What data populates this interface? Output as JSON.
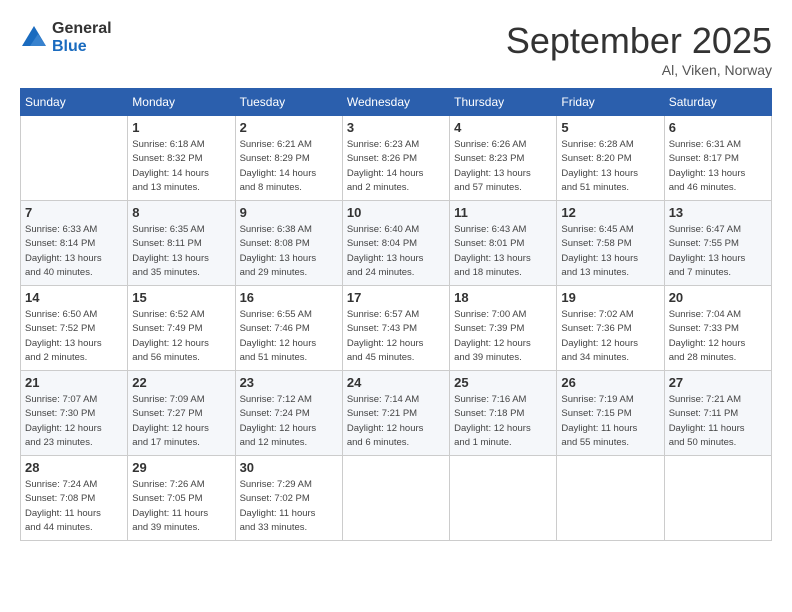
{
  "header": {
    "logo_general": "General",
    "logo_blue": "Blue",
    "month_title": "September 2025",
    "subtitle": "Al, Viken, Norway"
  },
  "weekdays": [
    "Sunday",
    "Monday",
    "Tuesday",
    "Wednesday",
    "Thursday",
    "Friday",
    "Saturday"
  ],
  "weeks": [
    [
      {
        "day": "",
        "info": ""
      },
      {
        "day": "1",
        "info": "Sunrise: 6:18 AM\nSunset: 8:32 PM\nDaylight: 14 hours\nand 13 minutes."
      },
      {
        "day": "2",
        "info": "Sunrise: 6:21 AM\nSunset: 8:29 PM\nDaylight: 14 hours\nand 8 minutes."
      },
      {
        "day": "3",
        "info": "Sunrise: 6:23 AM\nSunset: 8:26 PM\nDaylight: 14 hours\nand 2 minutes."
      },
      {
        "day": "4",
        "info": "Sunrise: 6:26 AM\nSunset: 8:23 PM\nDaylight: 13 hours\nand 57 minutes."
      },
      {
        "day": "5",
        "info": "Sunrise: 6:28 AM\nSunset: 8:20 PM\nDaylight: 13 hours\nand 51 minutes."
      },
      {
        "day": "6",
        "info": "Sunrise: 6:31 AM\nSunset: 8:17 PM\nDaylight: 13 hours\nand 46 minutes."
      }
    ],
    [
      {
        "day": "7",
        "info": "Sunrise: 6:33 AM\nSunset: 8:14 PM\nDaylight: 13 hours\nand 40 minutes."
      },
      {
        "day": "8",
        "info": "Sunrise: 6:35 AM\nSunset: 8:11 PM\nDaylight: 13 hours\nand 35 minutes."
      },
      {
        "day": "9",
        "info": "Sunrise: 6:38 AM\nSunset: 8:08 PM\nDaylight: 13 hours\nand 29 minutes."
      },
      {
        "day": "10",
        "info": "Sunrise: 6:40 AM\nSunset: 8:04 PM\nDaylight: 13 hours\nand 24 minutes."
      },
      {
        "day": "11",
        "info": "Sunrise: 6:43 AM\nSunset: 8:01 PM\nDaylight: 13 hours\nand 18 minutes."
      },
      {
        "day": "12",
        "info": "Sunrise: 6:45 AM\nSunset: 7:58 PM\nDaylight: 13 hours\nand 13 minutes."
      },
      {
        "day": "13",
        "info": "Sunrise: 6:47 AM\nSunset: 7:55 PM\nDaylight: 13 hours\nand 7 minutes."
      }
    ],
    [
      {
        "day": "14",
        "info": "Sunrise: 6:50 AM\nSunset: 7:52 PM\nDaylight: 13 hours\nand 2 minutes."
      },
      {
        "day": "15",
        "info": "Sunrise: 6:52 AM\nSunset: 7:49 PM\nDaylight: 12 hours\nand 56 minutes."
      },
      {
        "day": "16",
        "info": "Sunrise: 6:55 AM\nSunset: 7:46 PM\nDaylight: 12 hours\nand 51 minutes."
      },
      {
        "day": "17",
        "info": "Sunrise: 6:57 AM\nSunset: 7:43 PM\nDaylight: 12 hours\nand 45 minutes."
      },
      {
        "day": "18",
        "info": "Sunrise: 7:00 AM\nSunset: 7:39 PM\nDaylight: 12 hours\nand 39 minutes."
      },
      {
        "day": "19",
        "info": "Sunrise: 7:02 AM\nSunset: 7:36 PM\nDaylight: 12 hours\nand 34 minutes."
      },
      {
        "day": "20",
        "info": "Sunrise: 7:04 AM\nSunset: 7:33 PM\nDaylight: 12 hours\nand 28 minutes."
      }
    ],
    [
      {
        "day": "21",
        "info": "Sunrise: 7:07 AM\nSunset: 7:30 PM\nDaylight: 12 hours\nand 23 minutes."
      },
      {
        "day": "22",
        "info": "Sunrise: 7:09 AM\nSunset: 7:27 PM\nDaylight: 12 hours\nand 17 minutes."
      },
      {
        "day": "23",
        "info": "Sunrise: 7:12 AM\nSunset: 7:24 PM\nDaylight: 12 hours\nand 12 minutes."
      },
      {
        "day": "24",
        "info": "Sunrise: 7:14 AM\nSunset: 7:21 PM\nDaylight: 12 hours\nand 6 minutes."
      },
      {
        "day": "25",
        "info": "Sunrise: 7:16 AM\nSunset: 7:18 PM\nDaylight: 12 hours\nand 1 minute."
      },
      {
        "day": "26",
        "info": "Sunrise: 7:19 AM\nSunset: 7:15 PM\nDaylight: 11 hours\nand 55 minutes."
      },
      {
        "day": "27",
        "info": "Sunrise: 7:21 AM\nSunset: 7:11 PM\nDaylight: 11 hours\nand 50 minutes."
      }
    ],
    [
      {
        "day": "28",
        "info": "Sunrise: 7:24 AM\nSunset: 7:08 PM\nDaylight: 11 hours\nand 44 minutes."
      },
      {
        "day": "29",
        "info": "Sunrise: 7:26 AM\nSunset: 7:05 PM\nDaylight: 11 hours\nand 39 minutes."
      },
      {
        "day": "30",
        "info": "Sunrise: 7:29 AM\nSunset: 7:02 PM\nDaylight: 11 hours\nand 33 minutes."
      },
      {
        "day": "",
        "info": ""
      },
      {
        "day": "",
        "info": ""
      },
      {
        "day": "",
        "info": ""
      },
      {
        "day": "",
        "info": ""
      }
    ]
  ]
}
